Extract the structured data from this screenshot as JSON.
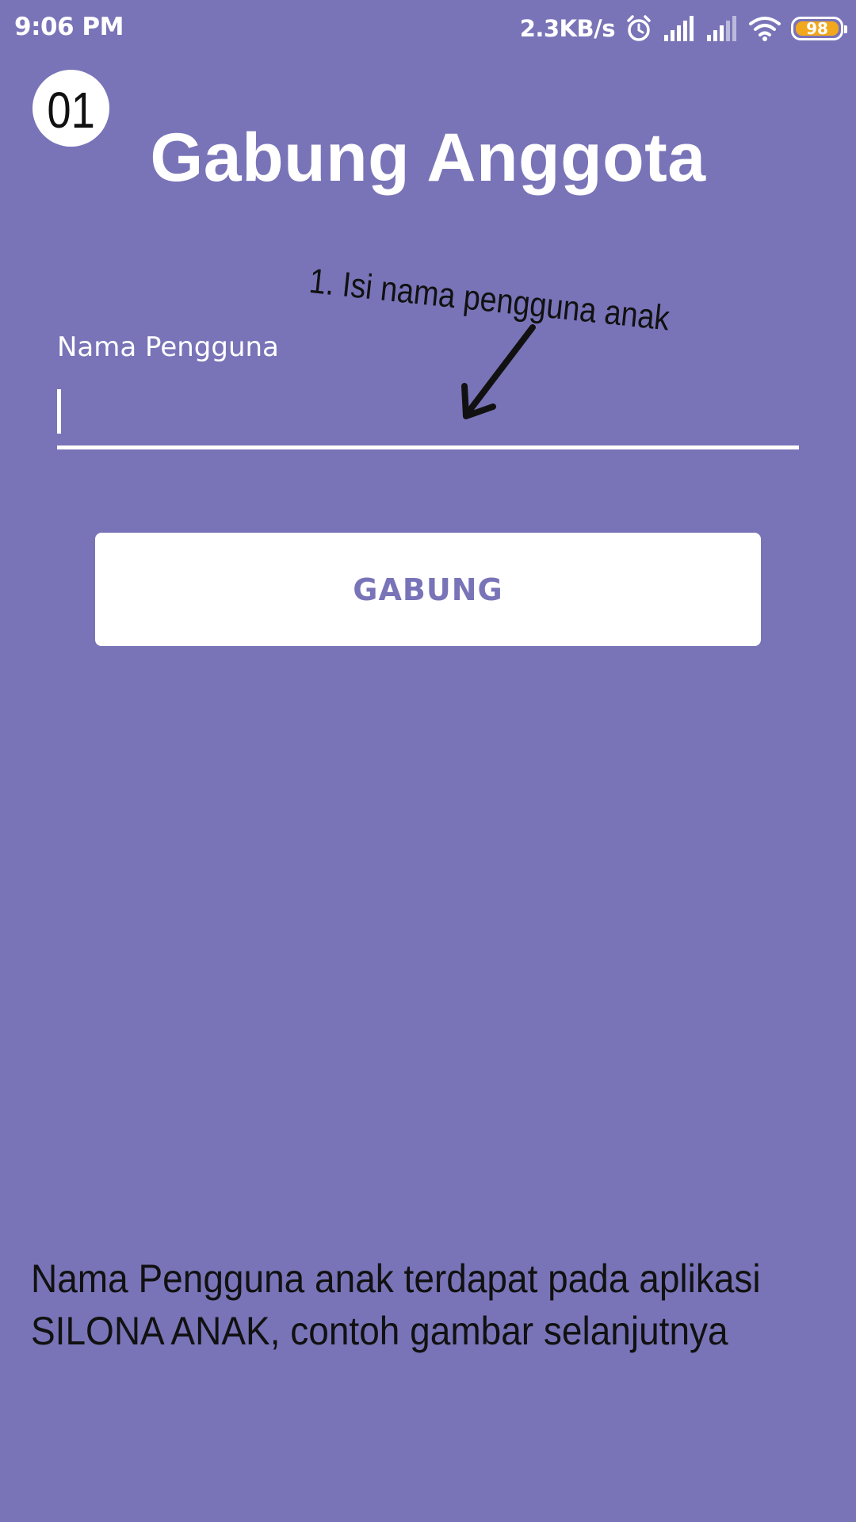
{
  "status_bar": {
    "time": "9:06 PM",
    "net_speed": "2.3KB/s",
    "battery": "98",
    "icons": [
      "alarm-icon",
      "signal-icon",
      "signal-icon-2",
      "wifi-icon",
      "battery-icon"
    ],
    "battery_color": "#f2a81d"
  },
  "step_badge": "01",
  "title": "Gabung Anggota",
  "annotation": "1. Isi nama pengguna anak",
  "form": {
    "username_label": "Nama Pengguna",
    "username_value": "",
    "join_button_label": "GABUNG"
  },
  "note": {
    "line1": "Nama Pengguna anak terdapat pada aplikasi",
    "line2": "SILONA ANAK, contoh gambar selanjutnya"
  },
  "colors": {
    "background": "#7974b8",
    "button_text": "#7974b8",
    "annotation": "#111111"
  }
}
